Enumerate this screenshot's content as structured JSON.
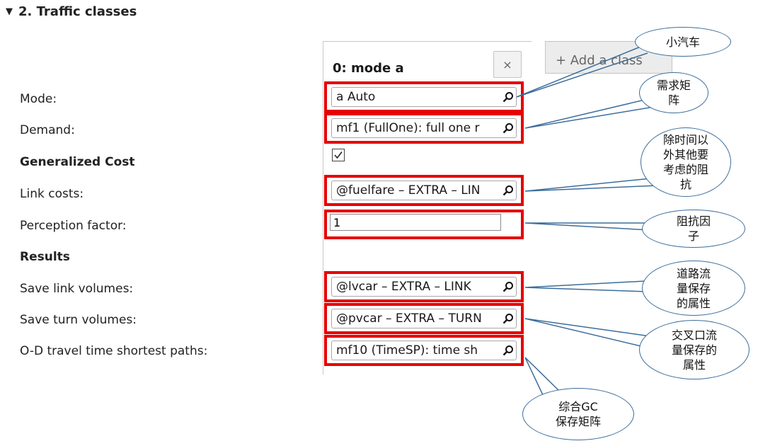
{
  "section": {
    "title": "2. Traffic classes"
  },
  "labels": {
    "mode": "Mode:",
    "demand": "Demand:",
    "generalized_cost": "Generalized Cost",
    "link_costs": "Link costs:",
    "perception_factor": "Perception factor:",
    "results": "Results",
    "save_link_volumes": "Save link volumes:",
    "save_turn_volumes": "Save turn volumes:",
    "od_travel_time": "O-D travel time shortest paths:"
  },
  "tabs": {
    "active_title": "0: mode a",
    "close_glyph": "×",
    "add_label": "+ Add a class"
  },
  "fields": {
    "mode": "a Auto",
    "demand": "mf1 (FullOne): full one r",
    "generalized_cost_checked": true,
    "link_costs": "@fuelfare – EXTRA – LIN",
    "perception_factor": "1",
    "save_link_volumes": "@lvcar – EXTRA – LINK",
    "save_turn_volumes": "@pvcar – EXTRA – TURN",
    "od_travel_time": "mf10 (TimeSP):  time sh"
  },
  "callouts": {
    "car": "小汽车",
    "demand_matrix": "需求矩\n阵",
    "other_costs": "除时间以\n外其他要\n考虑的阻\n抗",
    "perception": "阻抗因\n子",
    "link_volume_attr": "道路流\n量保存\n的属性",
    "turn_volume_attr": "交叉口流\n量保存的\n属性",
    "gc_matrix": "综合GC\n保存矩阵"
  },
  "colors": {
    "highlight": "#e60000",
    "callout_border": "#3c6d9c"
  }
}
